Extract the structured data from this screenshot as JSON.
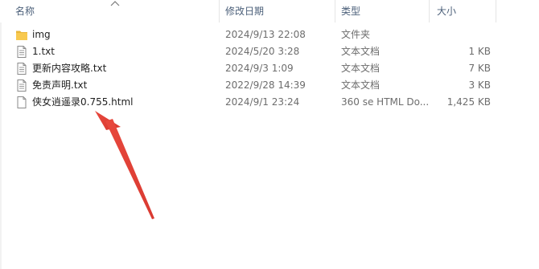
{
  "columns": {
    "name": "名称",
    "date": "修改日期",
    "type": "类型",
    "size": "大小"
  },
  "files": [
    {
      "name": "img",
      "date": "2024/9/13 22:08",
      "type": "文件夹",
      "size": "",
      "icon": "folder-icon"
    },
    {
      "name": "1.txt",
      "date": "2024/5/20 3:28",
      "type": "文本文档",
      "size": "1 KB",
      "icon": "text-file-icon"
    },
    {
      "name": "更新内容攻略.txt",
      "date": "2024/9/3 1:09",
      "type": "文本文档",
      "size": "7 KB",
      "icon": "text-file-icon"
    },
    {
      "name": "免责声明.txt",
      "date": "2022/9/28 14:39",
      "type": "文本文档",
      "size": "3 KB",
      "icon": "text-file-icon"
    },
    {
      "name": "侠女逍遥录0.755.html",
      "date": "2024/9/1 23:24",
      "type": "360 se HTML Do...",
      "size": "1,425 KB",
      "icon": "html-file-icon"
    }
  ],
  "colors": {
    "header_text": "#4c607a",
    "folder": "#f8c94f",
    "arrow": "#e8483d"
  }
}
